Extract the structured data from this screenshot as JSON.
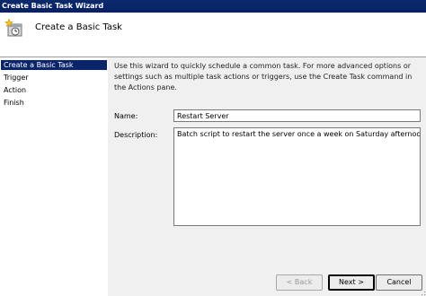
{
  "window": {
    "title": "Create Basic Task Wizard"
  },
  "header": {
    "title": "Create a Basic Task",
    "icon": "task-scheduler-icon"
  },
  "sidebar": {
    "items": [
      {
        "label": "Create a Basic Task",
        "active": true
      },
      {
        "label": "Trigger",
        "active": false
      },
      {
        "label": "Action",
        "active": false
      },
      {
        "label": "Finish",
        "active": false
      }
    ]
  },
  "main": {
    "intro": "Use this wizard to quickly schedule a common task.  For more advanced options or settings such as multiple task actions or triggers, use the Create Task command in the Actions pane.",
    "name_label": "Name:",
    "name_value": "Restart Server",
    "description_label": "Description:",
    "description_value": "Batch script to restart the server once a week on Saturday afternoon."
  },
  "buttons": {
    "back": "< Back",
    "next": "Next >",
    "cancel": "Cancel"
  },
  "colors": {
    "titlebar": "#0a246a",
    "selection": "#0a246a",
    "panel": "#f0f0f0"
  }
}
